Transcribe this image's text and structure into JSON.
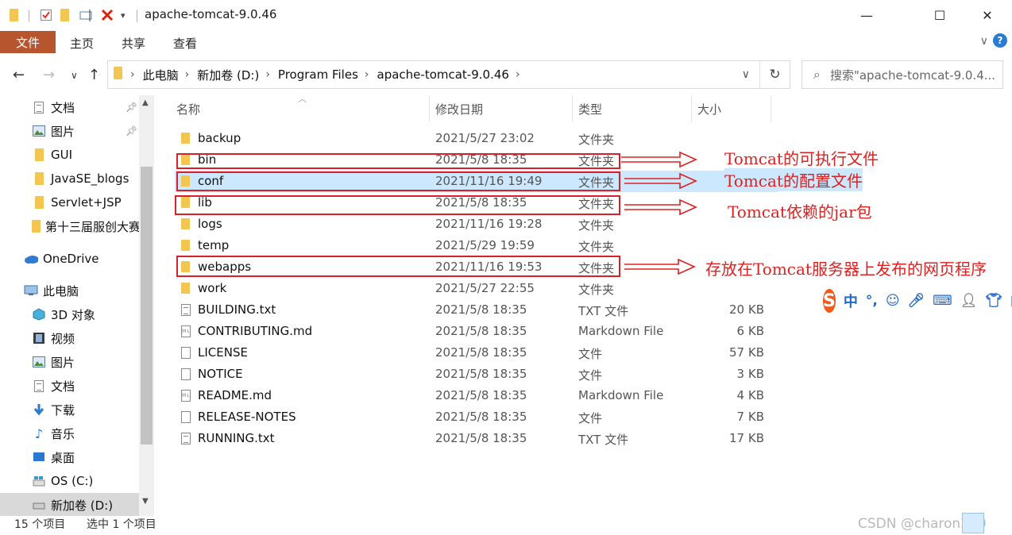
{
  "window": {
    "title": "apache-tomcat-9.0.46",
    "minimize": "—",
    "maximize": "☐",
    "close": "✕"
  },
  "ribbon": {
    "file": "文件",
    "home": "主页",
    "share": "共享",
    "view": "查看",
    "help": "?"
  },
  "address": {
    "crumbs": [
      "此电脑",
      "新加卷 (D:)",
      "Program Files",
      "apache-tomcat-9.0.46"
    ],
    "search_placeholder": "搜索\"apache-tomcat-9.0.4..."
  },
  "sidebar": {
    "items": [
      {
        "label": "文档",
        "icon": "documents-icon",
        "pinned": true
      },
      {
        "label": "图片",
        "icon": "pictures-icon",
        "pinned": true
      },
      {
        "label": "GUI",
        "icon": "folder-icon"
      },
      {
        "label": "JavaSE_blogs",
        "icon": "folder-icon"
      },
      {
        "label": "Servlet+JSP",
        "icon": "folder-icon"
      },
      {
        "label": "第十三届服创大赛",
        "icon": "folder-icon"
      },
      {
        "label": "OneDrive",
        "icon": "onedrive-icon"
      },
      {
        "label": "此电脑",
        "icon": "this-pc-icon"
      },
      {
        "label": "3D 对象",
        "icon": "3d-objects-icon"
      },
      {
        "label": "视频",
        "icon": "videos-icon"
      },
      {
        "label": "图片",
        "icon": "pictures-icon"
      },
      {
        "label": "文档",
        "icon": "documents-icon"
      },
      {
        "label": "下载",
        "icon": "downloads-icon"
      },
      {
        "label": "音乐",
        "icon": "music-icon"
      },
      {
        "label": "桌面",
        "icon": "desktop-icon"
      },
      {
        "label": "OS (C:)",
        "icon": "drive-c-icon"
      },
      {
        "label": "新加卷 (D:)",
        "icon": "drive-d-icon",
        "selected": true
      }
    ]
  },
  "columns": {
    "name": "名称",
    "date": "修改日期",
    "type": "类型",
    "size": "大小"
  },
  "files": [
    {
      "name": "backup",
      "date": "2021/5/27 23:02",
      "type": "文件夹",
      "size": "",
      "kind": "folder"
    },
    {
      "name": "bin",
      "date": "2021/5/8 18:35",
      "type": "文件夹",
      "size": "",
      "kind": "folder"
    },
    {
      "name": "conf",
      "date": "2021/11/16 19:49",
      "type": "文件夹",
      "size": "",
      "kind": "folder",
      "selected": true
    },
    {
      "name": "lib",
      "date": "2021/5/8 18:35",
      "type": "文件夹",
      "size": "",
      "kind": "folder"
    },
    {
      "name": "logs",
      "date": "2021/11/16 19:28",
      "type": "文件夹",
      "size": "",
      "kind": "folder"
    },
    {
      "name": "temp",
      "date": "2021/5/29 19:59",
      "type": "文件夹",
      "size": "",
      "kind": "folder"
    },
    {
      "name": "webapps",
      "date": "2021/11/16 19:53",
      "type": "文件夹",
      "size": "",
      "kind": "folder"
    },
    {
      "name": "work",
      "date": "2021/5/27 22:55",
      "type": "文件夹",
      "size": "",
      "kind": "folder"
    },
    {
      "name": "BUILDING.txt",
      "date": "2021/5/8 18:35",
      "type": "TXT 文件",
      "size": "20 KB",
      "kind": "txt"
    },
    {
      "name": "CONTRIBUTING.md",
      "date": "2021/5/8 18:35",
      "type": "Markdown File",
      "size": "6 KB",
      "kind": "md"
    },
    {
      "name": "LICENSE",
      "date": "2021/5/8 18:35",
      "type": "文件",
      "size": "57 KB",
      "kind": "file"
    },
    {
      "name": "NOTICE",
      "date": "2021/5/8 18:35",
      "type": "文件",
      "size": "3 KB",
      "kind": "file"
    },
    {
      "name": "README.md",
      "date": "2021/5/8 18:35",
      "type": "Markdown File",
      "size": "4 KB",
      "kind": "md"
    },
    {
      "name": "RELEASE-NOTES",
      "date": "2021/5/8 18:35",
      "type": "文件",
      "size": "7 KB",
      "kind": "file"
    },
    {
      "name": "RUNNING.txt",
      "date": "2021/5/8 18:35",
      "type": "TXT 文件",
      "size": "17 KB",
      "kind": "txt"
    }
  ],
  "annotations": {
    "bin": "Tomcat的可执行文件",
    "conf": "Tomcat的配置文件",
    "lib": "Tomcat依赖的jar包",
    "webapps": "存放在Tomcat服务器上发布的网页程序"
  },
  "ime": {
    "logo": "S",
    "mode": "中"
  },
  "status": {
    "count": "15 个项目",
    "selected": "选中 1 个项目",
    "watermark": "CSDN @charon2002"
  },
  "colors": {
    "file_tab": "#b6552e",
    "selection": "#cce8ff",
    "annotation": "#e02020",
    "folder": "#f2c650"
  }
}
